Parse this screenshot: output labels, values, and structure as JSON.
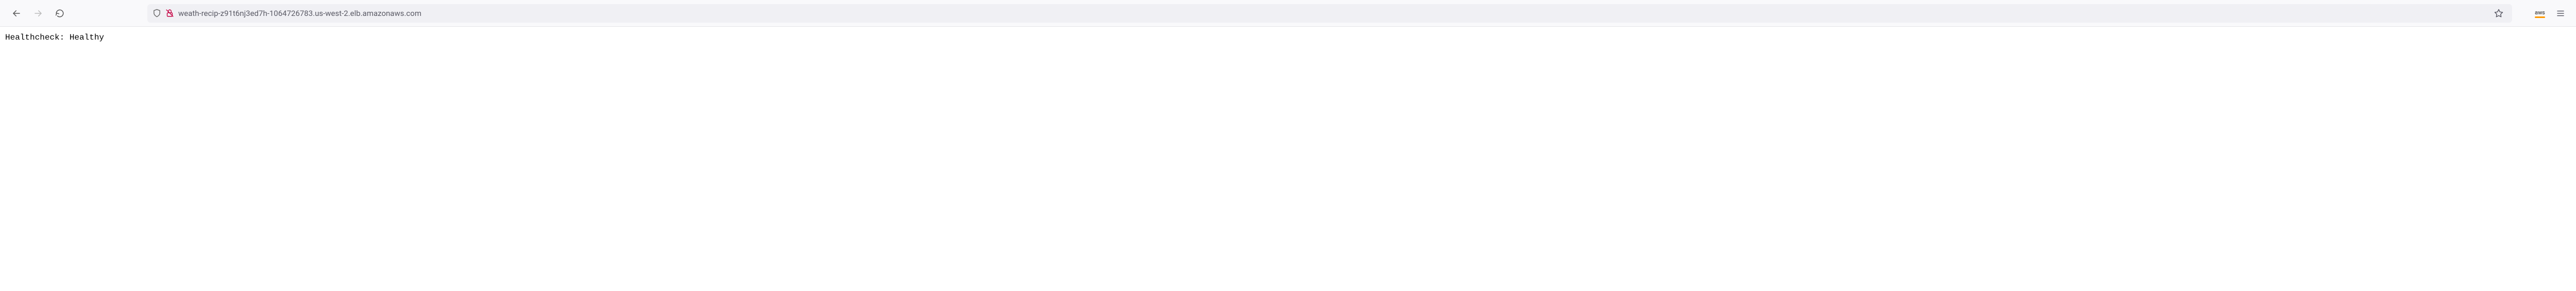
{
  "toolbar": {
    "url": "weath-recip-z91t6nj3ed7h-1064726783.us-west-2.elb.amazonaws.com"
  },
  "extension": {
    "label": "aws"
  },
  "page": {
    "body_text": "Healthcheck: Healthy"
  }
}
